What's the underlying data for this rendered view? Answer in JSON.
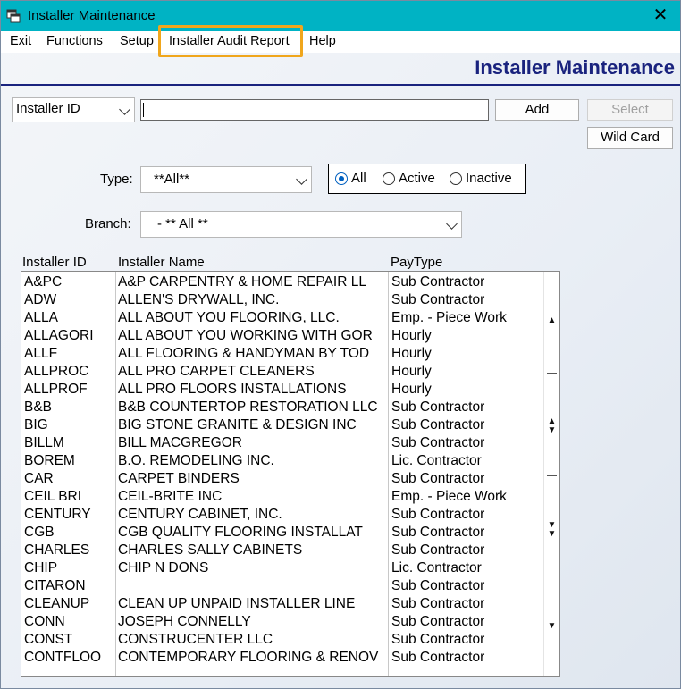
{
  "window": {
    "title": "Installer Maintenance",
    "close_glyph": "✕"
  },
  "menu": {
    "items": [
      "Exit",
      "Functions",
      "Setup",
      "Installer Audit Report",
      "Help"
    ]
  },
  "header": {
    "title": "Installer Maintenance"
  },
  "search": {
    "field_select": "Installer ID",
    "value": ""
  },
  "buttons": {
    "add": "Add",
    "select": "Select",
    "wild_card": "Wild Card"
  },
  "filters": {
    "type_label": "Type:",
    "type_value": "**All**",
    "branch_label": "Branch:",
    "branch_value": "- ** All **",
    "status_options": [
      "All",
      "Active",
      "Inactive"
    ],
    "status_selected": "All"
  },
  "table": {
    "columns": [
      "Installer ID",
      "Installer Name",
      "PayType"
    ],
    "rows": [
      {
        "id": "A&PC",
        "name": "A&P CARPENTRY & HOME REPAIR LL",
        "pay": "Sub Contractor"
      },
      {
        "id": "ADW",
        "name": "ALLEN'S DRYWALL, INC.",
        "pay": "Sub Contractor"
      },
      {
        "id": "ALLA",
        "name": "ALL ABOUT YOU FLOORING, LLC.",
        "pay": "Emp. - Piece Work"
      },
      {
        "id": "ALLAGORI",
        "name": "ALL ABOUT YOU WORKING WITH GOR",
        "pay": "Hourly"
      },
      {
        "id": "ALLF",
        "name": "ALL FLOORING & HANDYMAN BY TOD",
        "pay": "Hourly"
      },
      {
        "id": "ALLPROC",
        "name": "ALL PRO CARPET CLEANERS",
        "pay": "Hourly"
      },
      {
        "id": "ALLPROF",
        "name": "ALL PRO FLOORS INSTALLATIONS",
        "pay": "Hourly"
      },
      {
        "id": "B&B",
        "name": "B&B COUNTERTOP RESTORATION LLC",
        "pay": "Sub Contractor"
      },
      {
        "id": "BIG",
        "name": "BIG STONE GRANITE & DESIGN INC",
        "pay": "Sub Contractor"
      },
      {
        "id": "BILLM",
        "name": "BILL MACGREGOR",
        "pay": "Sub Contractor"
      },
      {
        "id": "BOREM",
        "name": "B.O. REMODELING INC.",
        "pay": "Lic. Contractor"
      },
      {
        "id": "CAR",
        "name": "CARPET BINDERS",
        "pay": "Sub Contractor"
      },
      {
        "id": "CEIL BRI",
        "name": "CEIL-BRITE INC",
        "pay": "Emp. - Piece Work"
      },
      {
        "id": "CENTURY",
        "name": "CENTURY CABINET, INC.",
        "pay": "Sub Contractor"
      },
      {
        "id": "CGB",
        "name": "CGB QUALITY FLOORING INSTALLAT",
        "pay": "Sub Contractor"
      },
      {
        "id": "CHARLES",
        "name": "CHARLES SALLY CABINETS",
        "pay": "Sub Contractor"
      },
      {
        "id": "CHIP",
        "name": "CHIP N DONS",
        "pay": "Lic. Contractor"
      },
      {
        "id": "CITARON",
        "name": "",
        "pay": "Sub Contractor"
      },
      {
        "id": "CLEANUP",
        "name": "CLEAN UP UNPAID INSTALLER LINE",
        "pay": "Sub Contractor"
      },
      {
        "id": "CONN",
        "name": "JOSEPH CONNELLY",
        "pay": "Sub Contractor"
      },
      {
        "id": "CONST",
        "name": "CONSTRUCENTER LLC",
        "pay": "Sub Contractor"
      },
      {
        "id": "CONTFLOO",
        "name": "CONTEMPORARY FLOORING & RENOV",
        "pay": "Sub Contractor"
      }
    ]
  },
  "colors": {
    "titlebar": "#00b3c4",
    "header_title": "#1a237e",
    "highlight": "#f0a61c",
    "radio_selected": "#0060c0"
  },
  "icons": {
    "app": "app-window-icon",
    "close": "close-icon",
    "dropdown": "chevron-down-icon"
  }
}
